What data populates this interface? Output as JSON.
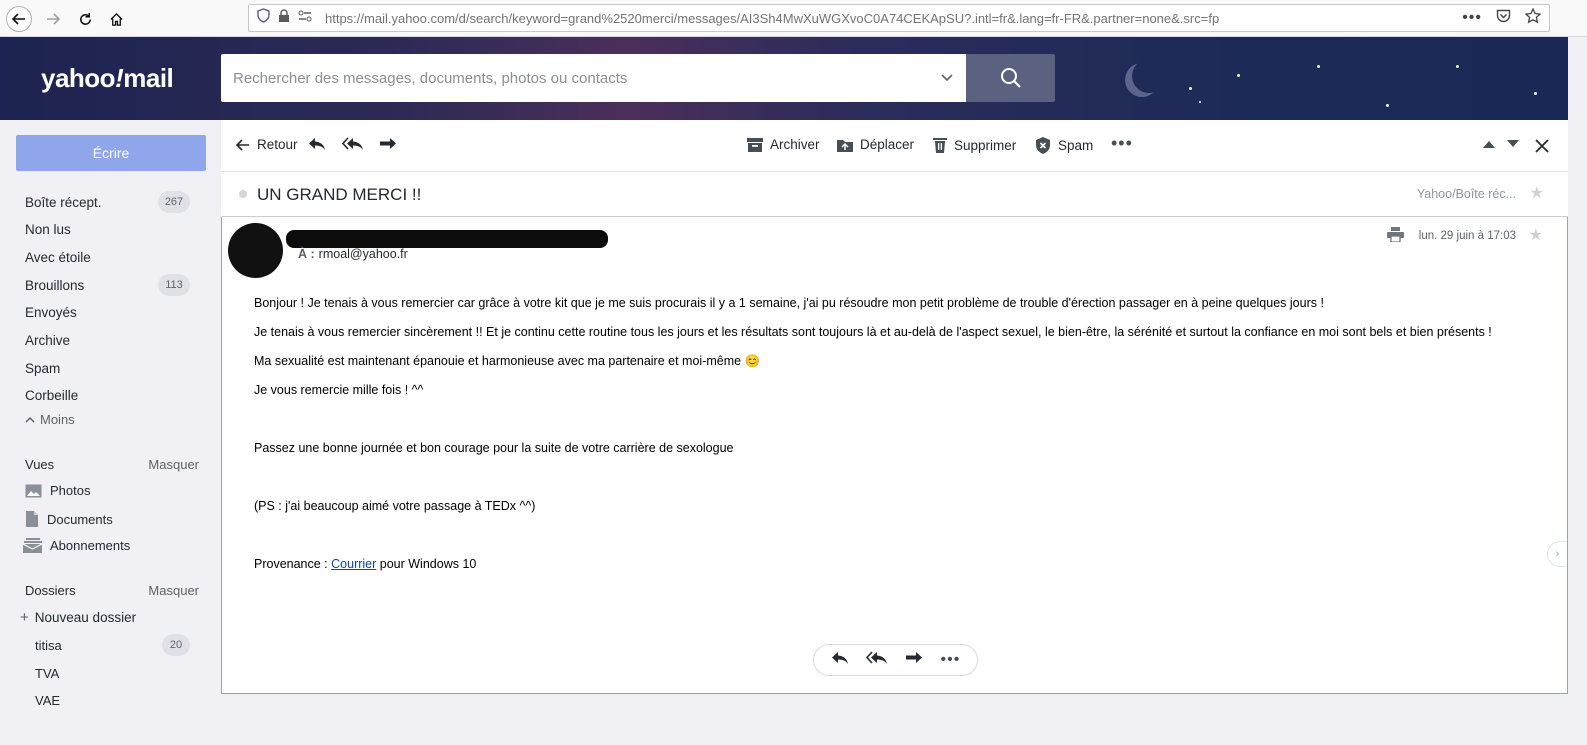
{
  "browser": {
    "url": "https://mail.yahoo.com/d/search/keyword=grand%2520merci/messages/AI3Sh4MwXuWGXvoC0A74CEKApSU?.intl=fr&.lang=fr-FR&.partner=none&.src=fp"
  },
  "header": {
    "logo_text": "yahoo",
    "logo_bang": "!",
    "logo_mail": "mail",
    "search_placeholder": "Rechercher des messages, documents, photos ou contacts"
  },
  "sidebar": {
    "compose_label": "Écrire",
    "folders": [
      {
        "label": "Boîte récept.",
        "count": "267"
      },
      {
        "label": "Non lus",
        "count": ""
      },
      {
        "label": "Avec étoile",
        "count": ""
      },
      {
        "label": "Brouillons",
        "count": "113"
      },
      {
        "label": "Envoyés",
        "count": ""
      },
      {
        "label": "Archive",
        "count": ""
      },
      {
        "label": "Spam",
        "count": ""
      },
      {
        "label": "Corbeille",
        "count": ""
      }
    ],
    "less_label": "Moins",
    "views_title": "Vues",
    "views_hide": "Masquer",
    "views": [
      {
        "label": "Photos"
      },
      {
        "label": "Documents"
      },
      {
        "label": "Abonnements"
      }
    ],
    "folders_title": "Dossiers",
    "folders_hide": "Masquer",
    "new_folder_label": "Nouveau dossier",
    "user_folders": [
      {
        "label": "titisa",
        "count": "20"
      },
      {
        "label": "TVA",
        "count": ""
      },
      {
        "label": "VAE",
        "count": ""
      }
    ]
  },
  "toolbar": {
    "back_label": "Retour",
    "archive_label": "Archiver",
    "move_label": "Déplacer",
    "delete_label": "Supprimer",
    "spam_label": "Spam"
  },
  "message": {
    "subject": "UN GRAND MERCI !!",
    "folder_tag": "Yahoo/Boîte réc...",
    "to_label": "À :",
    "to_address": "rmoal@yahoo.fr",
    "date": "lun. 29 juin à 17:03",
    "p1": "Bonjour ! Je tenais à vous remercier car grâce à votre kit que je me suis procurais il y a 1 semaine, j'ai pu résoudre mon petit problème de trouble d'érection passager en à peine quelques jours !",
    "p2": "Je tenais à vous remercier sincèrement !! Et je continu cette routine tous les jours et les résultats sont toujours là et au-delà de l'aspect sexuel, le bien-être, la sérénité et surtout la confiance en moi sont bels et bien présents !",
    "p3": "Ma sexualité est maintenant épanouie et harmonieuse avec ma partenaire et moi-même",
    "p3_emoji": "😊",
    "p4": "Je vous remercie mille fois ! ^^",
    "p5": "Passez une bonne journée et bon courage pour la suite de votre carrière de sexologue",
    "p6": "(PS : j'ai beaucoup aimé votre passage à TEDx ^^)",
    "p7_prefix": "Provenance : ",
    "p7_link": "Courrier",
    "p7_suffix": " pour Windows 10"
  },
  "colors": {
    "compose_bg": "#8fa6eb",
    "header_bg": "#1d2350",
    "link": "#0b44b2"
  }
}
